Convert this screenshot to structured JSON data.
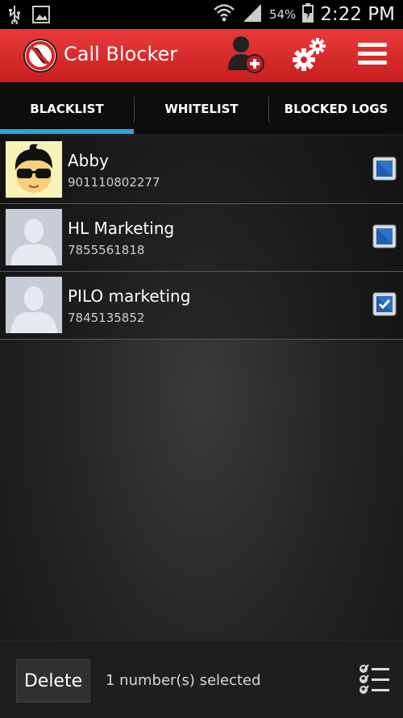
{
  "status_bar": {
    "battery_percent": "54%",
    "time": "2:22 PM",
    "icons": [
      "usb-icon",
      "image-icon",
      "wifi-icon",
      "signal-icon",
      "battery-charging-icon"
    ]
  },
  "app_bar": {
    "title": "Call Blocker",
    "actions": [
      "add-contact-icon",
      "settings-icon",
      "menu-icon"
    ],
    "color": "#d82a2a"
  },
  "tabs": [
    {
      "label": "BLACKLIST",
      "active": true
    },
    {
      "label": "WHITELIST",
      "active": false
    },
    {
      "label": "BLOCKED LOGS",
      "active": false
    }
  ],
  "accent": "#33a3dc",
  "contacts": [
    {
      "name": "Abby",
      "number": "901110802277",
      "checked": false,
      "avatar": "cartoon-avatar"
    },
    {
      "name": "HL Marketing",
      "number": "7855561818",
      "checked": false,
      "avatar": "default-avatar"
    },
    {
      "name": "PILO marketing",
      "number": "7845135852",
      "checked": true,
      "avatar": "default-avatar"
    }
  ],
  "bottom_bar": {
    "delete_label": "Delete",
    "selection_text": "1 number(s) selected"
  }
}
